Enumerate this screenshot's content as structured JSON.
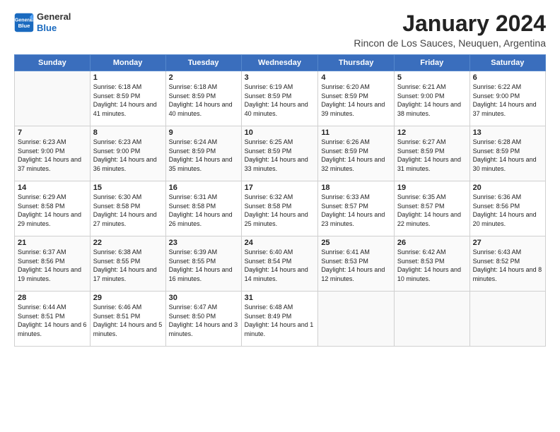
{
  "logo": {
    "general": "General",
    "blue": "Blue"
  },
  "title": "January 2024",
  "subtitle": "Rincon de Los Sauces, Neuquen, Argentina",
  "headers": [
    "Sunday",
    "Monday",
    "Tuesday",
    "Wednesday",
    "Thursday",
    "Friday",
    "Saturday"
  ],
  "weeks": [
    [
      {
        "date": "",
        "sunrise": "",
        "sunset": "",
        "daylight": ""
      },
      {
        "date": "1",
        "sunrise": "Sunrise: 6:18 AM",
        "sunset": "Sunset: 8:59 PM",
        "daylight": "Daylight: 14 hours and 41 minutes."
      },
      {
        "date": "2",
        "sunrise": "Sunrise: 6:18 AM",
        "sunset": "Sunset: 8:59 PM",
        "daylight": "Daylight: 14 hours and 40 minutes."
      },
      {
        "date": "3",
        "sunrise": "Sunrise: 6:19 AM",
        "sunset": "Sunset: 8:59 PM",
        "daylight": "Daylight: 14 hours and 40 minutes."
      },
      {
        "date": "4",
        "sunrise": "Sunrise: 6:20 AM",
        "sunset": "Sunset: 8:59 PM",
        "daylight": "Daylight: 14 hours and 39 minutes."
      },
      {
        "date": "5",
        "sunrise": "Sunrise: 6:21 AM",
        "sunset": "Sunset: 9:00 PM",
        "daylight": "Daylight: 14 hours and 38 minutes."
      },
      {
        "date": "6",
        "sunrise": "Sunrise: 6:22 AM",
        "sunset": "Sunset: 9:00 PM",
        "daylight": "Daylight: 14 hours and 37 minutes."
      }
    ],
    [
      {
        "date": "7",
        "sunrise": "Sunrise: 6:23 AM",
        "sunset": "Sunset: 9:00 PM",
        "daylight": "Daylight: 14 hours and 37 minutes."
      },
      {
        "date": "8",
        "sunrise": "Sunrise: 6:23 AM",
        "sunset": "Sunset: 9:00 PM",
        "daylight": "Daylight: 14 hours and 36 minutes."
      },
      {
        "date": "9",
        "sunrise": "Sunrise: 6:24 AM",
        "sunset": "Sunset: 8:59 PM",
        "daylight": "Daylight: 14 hours and 35 minutes."
      },
      {
        "date": "10",
        "sunrise": "Sunrise: 6:25 AM",
        "sunset": "Sunset: 8:59 PM",
        "daylight": "Daylight: 14 hours and 33 minutes."
      },
      {
        "date": "11",
        "sunrise": "Sunrise: 6:26 AM",
        "sunset": "Sunset: 8:59 PM",
        "daylight": "Daylight: 14 hours and 32 minutes."
      },
      {
        "date": "12",
        "sunrise": "Sunrise: 6:27 AM",
        "sunset": "Sunset: 8:59 PM",
        "daylight": "Daylight: 14 hours and 31 minutes."
      },
      {
        "date": "13",
        "sunrise": "Sunrise: 6:28 AM",
        "sunset": "Sunset: 8:59 PM",
        "daylight": "Daylight: 14 hours and 30 minutes."
      }
    ],
    [
      {
        "date": "14",
        "sunrise": "Sunrise: 6:29 AM",
        "sunset": "Sunset: 8:58 PM",
        "daylight": "Daylight: 14 hours and 29 minutes."
      },
      {
        "date": "15",
        "sunrise": "Sunrise: 6:30 AM",
        "sunset": "Sunset: 8:58 PM",
        "daylight": "Daylight: 14 hours and 27 minutes."
      },
      {
        "date": "16",
        "sunrise": "Sunrise: 6:31 AM",
        "sunset": "Sunset: 8:58 PM",
        "daylight": "Daylight: 14 hours and 26 minutes."
      },
      {
        "date": "17",
        "sunrise": "Sunrise: 6:32 AM",
        "sunset": "Sunset: 8:58 PM",
        "daylight": "Daylight: 14 hours and 25 minutes."
      },
      {
        "date": "18",
        "sunrise": "Sunrise: 6:33 AM",
        "sunset": "Sunset: 8:57 PM",
        "daylight": "Daylight: 14 hours and 23 minutes."
      },
      {
        "date": "19",
        "sunrise": "Sunrise: 6:35 AM",
        "sunset": "Sunset: 8:57 PM",
        "daylight": "Daylight: 14 hours and 22 minutes."
      },
      {
        "date": "20",
        "sunrise": "Sunrise: 6:36 AM",
        "sunset": "Sunset: 8:56 PM",
        "daylight": "Daylight: 14 hours and 20 minutes."
      }
    ],
    [
      {
        "date": "21",
        "sunrise": "Sunrise: 6:37 AM",
        "sunset": "Sunset: 8:56 PM",
        "daylight": "Daylight: 14 hours and 19 minutes."
      },
      {
        "date": "22",
        "sunrise": "Sunrise: 6:38 AM",
        "sunset": "Sunset: 8:55 PM",
        "daylight": "Daylight: 14 hours and 17 minutes."
      },
      {
        "date": "23",
        "sunrise": "Sunrise: 6:39 AM",
        "sunset": "Sunset: 8:55 PM",
        "daylight": "Daylight: 14 hours and 16 minutes."
      },
      {
        "date": "24",
        "sunrise": "Sunrise: 6:40 AM",
        "sunset": "Sunset: 8:54 PM",
        "daylight": "Daylight: 14 hours and 14 minutes."
      },
      {
        "date": "25",
        "sunrise": "Sunrise: 6:41 AM",
        "sunset": "Sunset: 8:53 PM",
        "daylight": "Daylight: 14 hours and 12 minutes."
      },
      {
        "date": "26",
        "sunrise": "Sunrise: 6:42 AM",
        "sunset": "Sunset: 8:53 PM",
        "daylight": "Daylight: 14 hours and 10 minutes."
      },
      {
        "date": "27",
        "sunrise": "Sunrise: 6:43 AM",
        "sunset": "Sunset: 8:52 PM",
        "daylight": "Daylight: 14 hours and 8 minutes."
      }
    ],
    [
      {
        "date": "28",
        "sunrise": "Sunrise: 6:44 AM",
        "sunset": "Sunset: 8:51 PM",
        "daylight": "Daylight: 14 hours and 6 minutes."
      },
      {
        "date": "29",
        "sunrise": "Sunrise: 6:46 AM",
        "sunset": "Sunset: 8:51 PM",
        "daylight": "Daylight: 14 hours and 5 minutes."
      },
      {
        "date": "30",
        "sunrise": "Sunrise: 6:47 AM",
        "sunset": "Sunset: 8:50 PM",
        "daylight": "Daylight: 14 hours and 3 minutes."
      },
      {
        "date": "31",
        "sunrise": "Sunrise: 6:48 AM",
        "sunset": "Sunset: 8:49 PM",
        "daylight": "Daylight: 14 hours and 1 minute."
      },
      {
        "date": "",
        "sunrise": "",
        "sunset": "",
        "daylight": ""
      },
      {
        "date": "",
        "sunrise": "",
        "sunset": "",
        "daylight": ""
      },
      {
        "date": "",
        "sunrise": "",
        "sunset": "",
        "daylight": ""
      }
    ]
  ]
}
